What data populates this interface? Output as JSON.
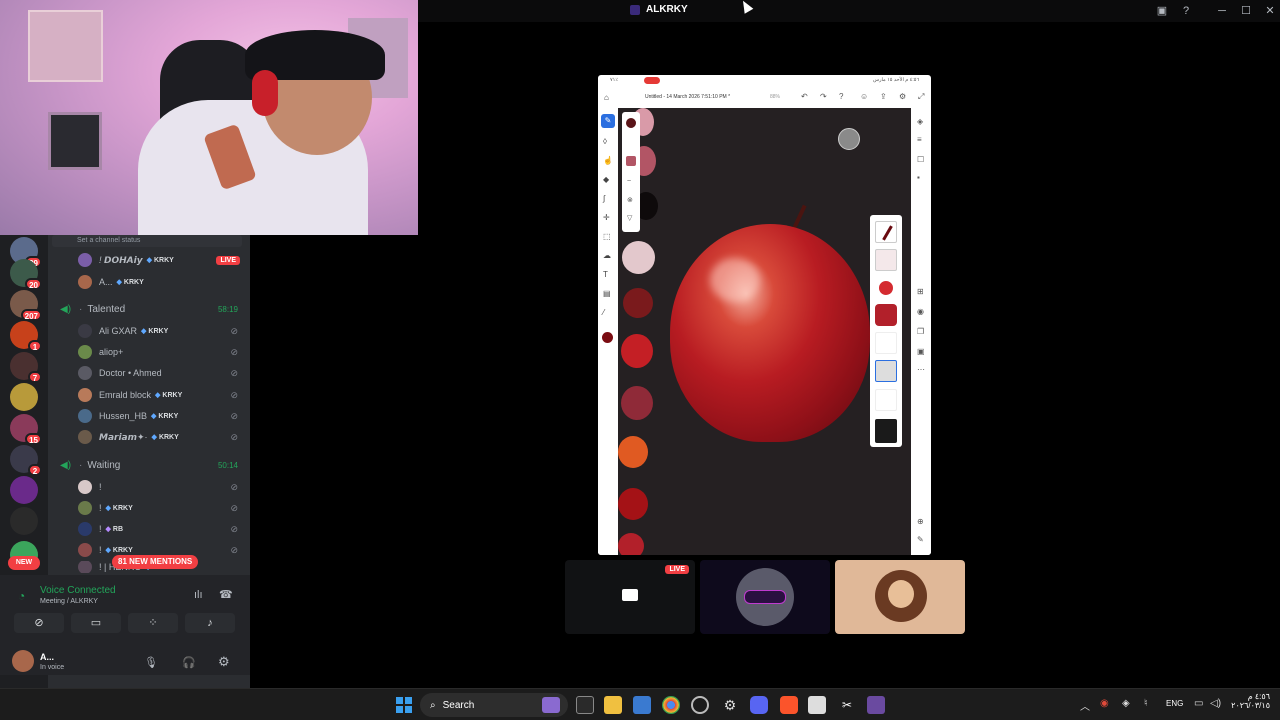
{
  "window": {
    "title": "ALKRKY"
  },
  "sidebar": {
    "servers": [
      {
        "badge": "99",
        "color": "#5b6b8c"
      },
      {
        "badge": "20",
        "color": "#3c5a4a"
      },
      {
        "badge": "207",
        "color": "#7a5a4a"
      },
      {
        "badge": "1",
        "color": "#c7411b"
      },
      {
        "badge": "7",
        "color": "#4a3030"
      },
      {
        "badge": "",
        "color": "#b89a3a"
      },
      {
        "badge": "15",
        "color": "#8a3a5a"
      },
      {
        "badge": "2",
        "color": "#3a3a4a"
      },
      {
        "badge": "",
        "color": "#6a2a8a"
      },
      {
        "badge": "",
        "color": "#2a2a2a"
      }
    ],
    "new_label": "NEW",
    "channel_status": "Set a channel status",
    "top_members": [
      {
        "name": "! 𝘿𝙊𝙃𝘼𝙞𝙮",
        "tag": "KRKY",
        "live": "LIVE"
      },
      {
        "name": "A...",
        "tag": "KRKY",
        "live": ""
      }
    ],
    "channels": [
      {
        "name": "Talented",
        "time": "58:19",
        "members": [
          {
            "name": "Ali GXAR",
            "tag": "KRKY"
          },
          {
            "name": "aliop+",
            "tag": ""
          },
          {
            "name": "Doctor • Ahmed",
            "tag": ""
          },
          {
            "name": "Emrald block",
            "tag": "KRKY"
          },
          {
            "name": "Hussen_HB",
            "tag": "KRKY"
          },
          {
            "name": "𝙈𝙖𝙧𝙞𝙖𝙢✦·",
            "tag": "KRKY"
          }
        ]
      },
      {
        "name": "Waiting",
        "time": "50:14",
        "members": [
          {
            "name": "!",
            "tag": ""
          },
          {
            "name": "!",
            "tag": "KRKY"
          },
          {
            "name": "!",
            "tag": "RB"
          },
          {
            "name": "!",
            "tag": "KRKY"
          },
          {
            "name": "! | HENRO",
            "tag": "PMC"
          }
        ]
      }
    ],
    "mentions": "81 NEW MENTIONS",
    "voice": {
      "status": "Voice Connected",
      "location": "Meeting / ALKRKY"
    },
    "user": {
      "name": "A...",
      "status": "In voice"
    }
  },
  "ipad": {
    "status_left": "٤:٥٦ م  الأحد ١٥ مارس",
    "status_right": "٧١٪",
    "doc_title": "Untitled - 14 March 2026 7:51:10 PM *",
    "zoom": "88%",
    "swatch_colors": [
      "#5a1418",
      "#d99aa8",
      "#b25565",
      "#0e0a0b",
      "#e3c8cc",
      "#7a1a1c",
      "#c41f25",
      "#8f2a38",
      "#e05a22",
      "#a41216",
      "#b2202a",
      "#7a0c12"
    ],
    "brush_colors": [
      "#6a0a10",
      "#b2202a",
      "#d42b30"
    ]
  },
  "call": {
    "live_label": "LIVE"
  },
  "taskbar": {
    "search_placeholder": "Search",
    "lang": "ENG",
    "clock_time": "٤:٥٦ م",
    "clock_date": "٢٠٢٦/٠٣/١٥"
  }
}
